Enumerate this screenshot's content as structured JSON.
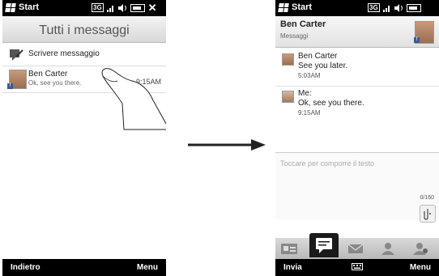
{
  "left_screen": {
    "status": {
      "start_label": "Start",
      "network": "3G"
    },
    "title": "Tutti i messaggi",
    "compose_label": "Scrivere messaggio",
    "thread": {
      "name": "Ben Carter",
      "preview": "Ok, see you there.",
      "time": "9:15AM"
    },
    "softkeys": {
      "left": "Indietro",
      "right": "Menu"
    }
  },
  "right_screen": {
    "status": {
      "start_label": "Start",
      "network": "3G"
    },
    "header": {
      "name": "Ben Carter",
      "subtitle": "Messaggi"
    },
    "messages": [
      {
        "sender": "Ben Carter",
        "text": "See you later.",
        "time": "5:03AM"
      },
      {
        "sender": "Me:",
        "text": "Ok, see you there.",
        "time": "9:15AM"
      }
    ],
    "compose_placeholder": "Toccare per comporre il testo",
    "char_counter": "0/160",
    "softkeys": {
      "left": "Invia",
      "right": "Menu"
    }
  },
  "icons": [
    "windows-flag-icon",
    "3g-icon",
    "signal-icon",
    "volume-icon",
    "battery-icon",
    "close-icon",
    "compose-icon",
    "facebook-badge-icon",
    "attach-icon",
    "keyboard-icon",
    "contact-card-icon",
    "messages-icon",
    "email-icon",
    "people-icon",
    "profile-icon",
    "finger-gesture-icon",
    "arrow-icon"
  ],
  "colors": {
    "status_bar": "#000000",
    "active_tab": "#1a1a1a",
    "facebook": "#3b5998"
  }
}
